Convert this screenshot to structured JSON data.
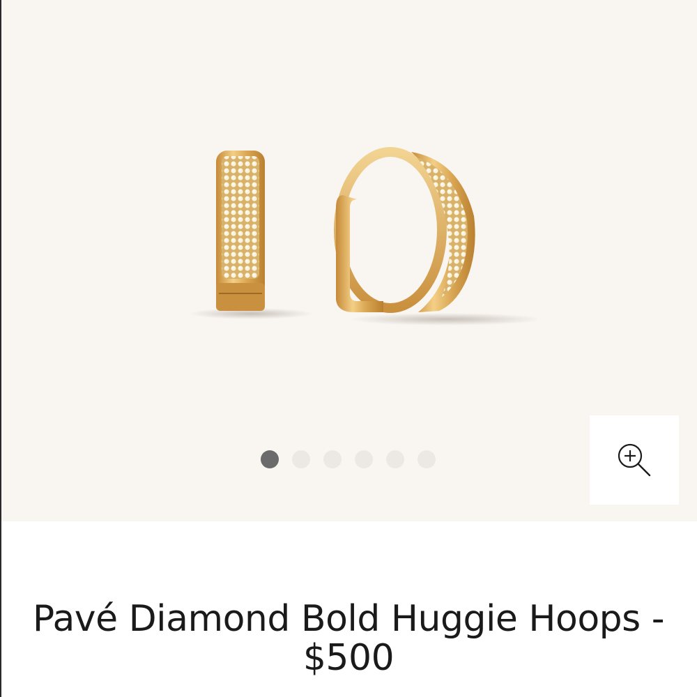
{
  "product": {
    "title": "Pavé Diamond Bold Huggie Hoops - $500"
  },
  "gallery": {
    "image_count": 6,
    "active_index": 0,
    "zoom_icon": "zoom-in-icon"
  },
  "colors": {
    "gallery_background": "#f9f6f2",
    "gold": "#d9a856",
    "active_dot": "#6b6b6b",
    "inactive_dot": "#ece9e5"
  }
}
